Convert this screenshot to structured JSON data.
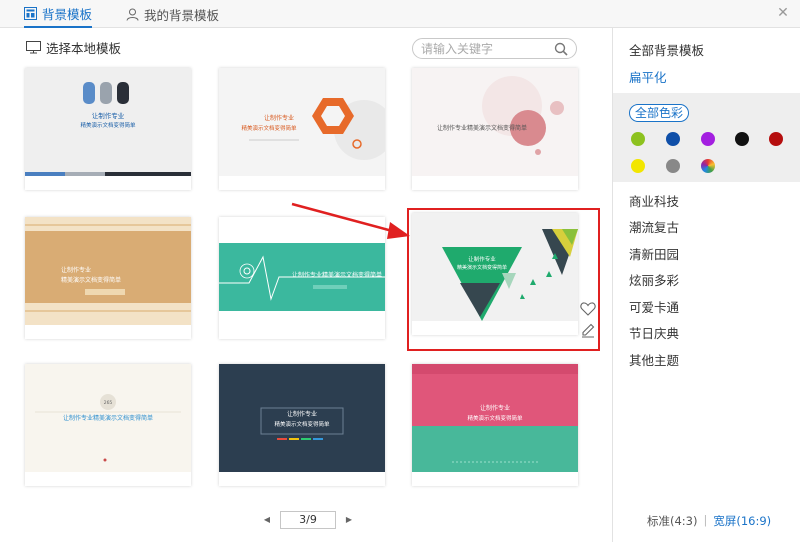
{
  "tabs": [
    {
      "label": "背景模板",
      "active": true
    },
    {
      "label": "我的背景模板",
      "active": false
    }
  ],
  "local_button": "选择本地模板",
  "search": {
    "placeholder": "请输入关键字"
  },
  "thumbnails": [
    {
      "title": "让制作专业",
      "subtitle": "精美演示文档变得简单"
    },
    {
      "title": "让制作专业",
      "subtitle": "精美演示文档变得简单"
    },
    {
      "title": "让制作专业精美演示文档变得简单"
    },
    {
      "title": "让制作专业",
      "subtitle": "精美演示文档变得简单"
    },
    {
      "title": "让制作专业精美演示文档变得简单"
    },
    {
      "title": "让制作专业",
      "subtitle": "精美演示文档变得简单"
    },
    {
      "badge": "265",
      "title": "让制作专业精美演示文档变得简单"
    },
    {
      "title": "让制作专业",
      "subtitle": "精美演示文档变得简单"
    },
    {
      "title": "让制作专业",
      "subtitle": "精美演示文档变得简单"
    }
  ],
  "pager": {
    "current": "3/9"
  },
  "right_panel": {
    "all_templates": "全部背景模板",
    "flat": "扁平化",
    "all_colors": "全部色彩",
    "swatches": [
      "#8dc21f",
      "#0f4fa8",
      "#a31fe0",
      "#111111",
      "#b50e0e",
      "#f2e600",
      "#888888",
      "rainbow"
    ],
    "categories": [
      "商业科技",
      "潮流复古",
      "清新田园",
      "炫丽多彩",
      "可爱卡通",
      "节日庆典",
      "其他主题"
    ],
    "ratio_standard": "标准(4:3)",
    "ratio_separator": "|",
    "ratio_wide": "宽屏(16:9)"
  },
  "colors": {
    "accent": "#1a73c8",
    "highlight": "#e02020"
  }
}
